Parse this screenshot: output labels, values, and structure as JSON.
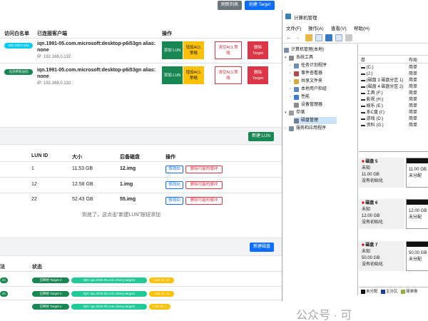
{
  "top_buttons": {
    "refresh": "刷新列表",
    "create_target": "创建 Target"
  },
  "targets": {
    "headers": {
      "whitelist": "访问白名单",
      "clients": "已连接客户端",
      "actions": "操作"
    },
    "rows": [
      {
        "whitelist": "192.168.0.132",
        "client_name": "iqn.1991-05.com.microsoft:desktop-p6i53gn alias:",
        "client_alias": "none",
        "client_ip": "IP: 192.168.0.132",
        "actions": [
          "添加 LUN",
          "增加ACL策略",
          "清空ACL策略",
          "删除 Target"
        ]
      },
      {
        "whitelist": "允许所有访问",
        "client_name": "iqn.1991-05.com.microsoft:desktop-p6i53gn alias:",
        "client_alias": "none",
        "client_ip": "IP: 192.168.0.132",
        "actions": [
          "添加 LUN",
          "增加ACL策略",
          "清空ACL策略",
          "删除 Target"
        ]
      }
    ]
  },
  "luns": {
    "new_button": "新建 LUN",
    "headers": {
      "lun_id": "LUN ID",
      "size": "大小",
      "backing": "后备磁盘",
      "actions": "操作"
    },
    "rows": [
      {
        "id": "1",
        "size": "11.53 GB",
        "disk": "12.img",
        "edit": "修改ID",
        "delete": "删除可能的缓冲"
      },
      {
        "id": "12",
        "size": "12.58 GB",
        "disk": "1.img",
        "edit": "修改ID",
        "delete": "删除可能的缓冲"
      },
      {
        "id": "22",
        "size": "52.43 GB",
        "disk": "55.img",
        "edit": "修改ID",
        "delete": "删除可能的缓冲"
      }
    ],
    "footer": "到底了，这点击\"新建LUN\"按钮添加"
  },
  "disks": {
    "new_button": "新建磁盘",
    "headers": {
      "col1": "法",
      "status": "状态"
    },
    "rows": [
      {
        "c1": "vC",
        "target": "已映射 Target 2",
        "iqn": "IQN: iqn.2025-05.com.cherry:target1",
        "lun": "LUN ID: 22"
      },
      {
        "c1": "vC",
        "target": "已映射 Target 2",
        "iqn": "IQN: iqn.2025-05.com.cherry:target1",
        "lun": "LUN ID: 12"
      },
      {
        "c1": "",
        "target": "已映射 Target 2",
        "iqn": "IQN: iqn.2025-05.com.cherry:target1",
        "lun": "LUN ID: 1"
      }
    ]
  },
  "window": {
    "title": "计算机管理",
    "menu": [
      "文件(F)",
      "操作(A)",
      "查看(V)",
      "帮助(H)"
    ],
    "tree": [
      {
        "label": "计算机管理(本地)",
        "level": 0
      },
      {
        "label": "系统工具",
        "level": 1
      },
      {
        "label": "任务计划程序",
        "level": 2
      },
      {
        "label": "事件查看器",
        "level": 2
      },
      {
        "label": "共享文件夹",
        "level": 2
      },
      {
        "label": "本地用户和组",
        "level": 2
      },
      {
        "label": "性能",
        "level": 2
      },
      {
        "label": "设备管理器",
        "level": 2
      },
      {
        "label": "存储",
        "level": 1
      },
      {
        "label": "磁盘管理",
        "level": 2
      },
      {
        "label": "服务和应用程序",
        "level": 1
      }
    ],
    "volume_headers": [
      "卷",
      "布局"
    ],
    "volumes": [
      {
        "name": "(C:)",
        "layout": "简单"
      },
      {
        "name": "(J:)",
        "layout": "简单"
      },
      {
        "name": "(磁盘 3 磁盘分区 1)",
        "layout": "简单"
      },
      {
        "name": "(磁盘 4 磁盘分区 2)",
        "layout": "简单"
      },
      {
        "name": "工具 (F:)",
        "layout": "简单"
      },
      {
        "name": "影视 (H:)",
        "layout": "简单"
      },
      {
        "name": "娱乐 (E:)",
        "layout": "简单"
      },
      {
        "name": "系C盘 (I:)",
        "layout": "简单"
      },
      {
        "name": "游戏 (D:)",
        "layout": "简单"
      },
      {
        "name": "资料 (G:)",
        "layout": "简单"
      }
    ],
    "disks": [
      {
        "name": "磁盘 5",
        "type": "未知",
        "size": "11.00 GB",
        "status": "没有初始化",
        "part_size": "11.00 GB",
        "part_status": "未分配"
      },
      {
        "name": "磁盘 6",
        "type": "未知",
        "size": "12.00 GB",
        "status": "没有初始化",
        "part_size": "12.00 GB",
        "part_status": "未分配"
      },
      {
        "name": "磁盘 7",
        "type": "未知",
        "size": "50.00 GB",
        "status": "没有初始化",
        "part_size": "50.00 GB",
        "part_status": "未分配"
      }
    ],
    "legend": [
      "未分配",
      "主分区",
      "简单卷"
    ]
  },
  "watermark": "公众号 · 可",
  "colors": {
    "primary": "#0d6efd",
    "success": "#198754",
    "warning": "#ffc107",
    "danger": "#dc3545",
    "info": "#0dcaf0"
  }
}
